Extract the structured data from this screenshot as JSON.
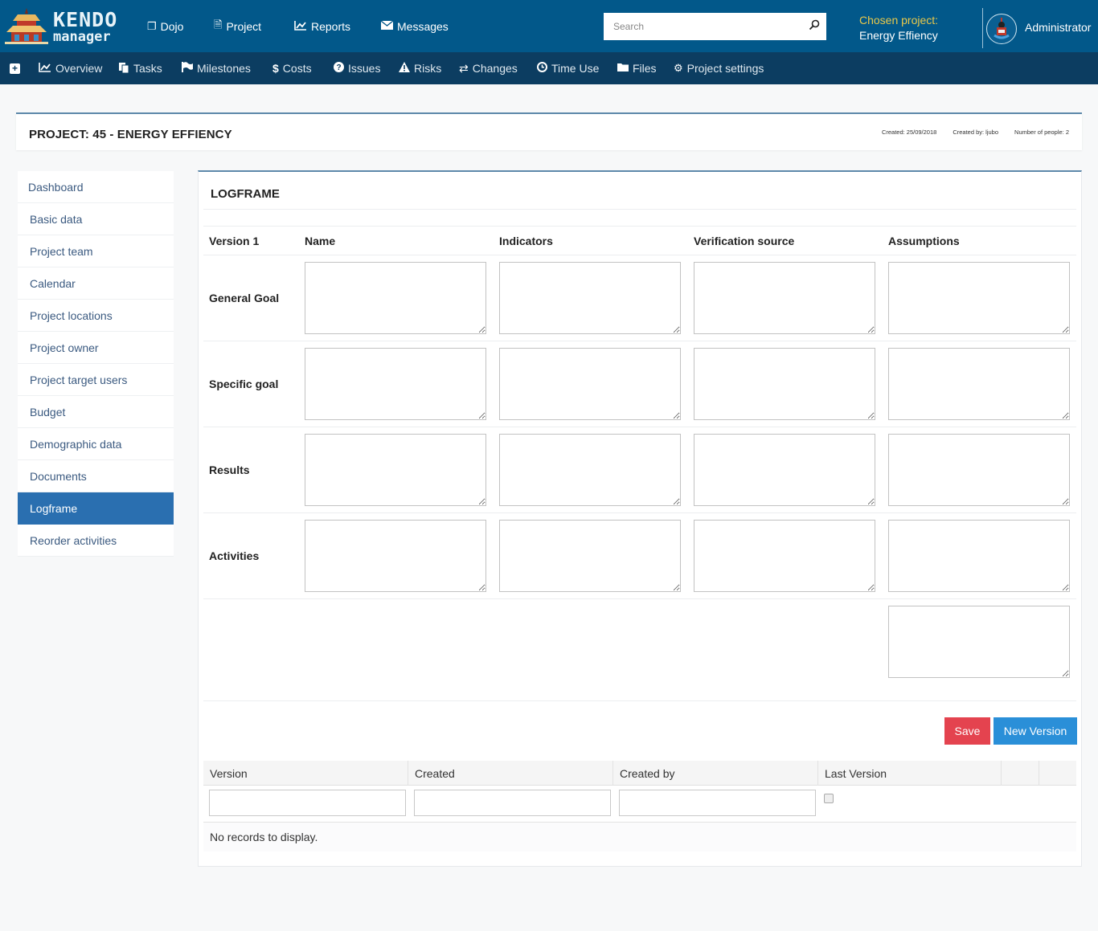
{
  "brand": {
    "line1": "KENDO",
    "line2": "manager"
  },
  "topnav": {
    "items": [
      {
        "label": "Dojo",
        "icon": "copy-icon"
      },
      {
        "label": "Project",
        "icon": "document-icon"
      },
      {
        "label": "Reports",
        "icon": "line-chart-icon"
      },
      {
        "label": "Messages",
        "icon": "envelope-icon"
      }
    ],
    "search_placeholder": "Search",
    "chosen_label": "Chosen project:",
    "chosen_value": "Energy Effiency",
    "user": "Administrator"
  },
  "subnav": {
    "items": [
      {
        "label": "Overview",
        "icon": "line-chart-icon"
      },
      {
        "label": "Tasks",
        "icon": "files-icon"
      },
      {
        "label": "Milestones",
        "icon": "flag-icon"
      },
      {
        "label": "Costs",
        "icon": "dollar-icon"
      },
      {
        "label": "Issues",
        "icon": "question-circle-icon"
      },
      {
        "label": "Risks",
        "icon": "warning-icon"
      },
      {
        "label": "Changes",
        "icon": "exchange-icon"
      },
      {
        "label": "Time Use",
        "icon": "clock-icon"
      },
      {
        "label": "Files",
        "icon": "folder-icon"
      },
      {
        "label": "Project settings",
        "icon": "cogs-icon"
      }
    ]
  },
  "project": {
    "title": "PROJECT: 45 - ENERGY EFFIENCY",
    "created": "Created: 25/09/2018",
    "created_by": "Created by: ljubo",
    "people": "Number of people: 2"
  },
  "sidebar": {
    "items": [
      {
        "label": "Dashboard",
        "active": false
      },
      {
        "label": "Basic data",
        "active": false
      },
      {
        "label": "Project team",
        "active": false
      },
      {
        "label": "Calendar",
        "active": false
      },
      {
        "label": "Project locations",
        "active": false
      },
      {
        "label": "Project owner",
        "active": false
      },
      {
        "label": "Project target users",
        "active": false
      },
      {
        "label": "Budget",
        "active": false
      },
      {
        "label": "Demographic data",
        "active": false
      },
      {
        "label": "Documents",
        "active": false
      },
      {
        "label": "Logframe",
        "active": true
      },
      {
        "label": "Reorder activities",
        "active": false
      }
    ]
  },
  "logframe": {
    "title": "LOGFRAME",
    "version_label": "Version 1",
    "columns": [
      "Name",
      "Indicators",
      "Verification source",
      "Assumptions"
    ],
    "rows": [
      "General Goal",
      "Specific goal",
      "Results",
      "Activities"
    ],
    "save_label": "Save",
    "new_version_label": "New Version"
  },
  "versions_grid": {
    "columns": [
      "Version",
      "Created",
      "Created by",
      "Last Version"
    ],
    "empty_message": "No records to display."
  },
  "colors": {
    "header_bg": "#02588a",
    "subnav_bg": "#0c3d61",
    "accent": "#2a6fb0",
    "save": "#e4434f",
    "new_version": "#2a8fd8",
    "chosen_label": "#e9c84a"
  }
}
